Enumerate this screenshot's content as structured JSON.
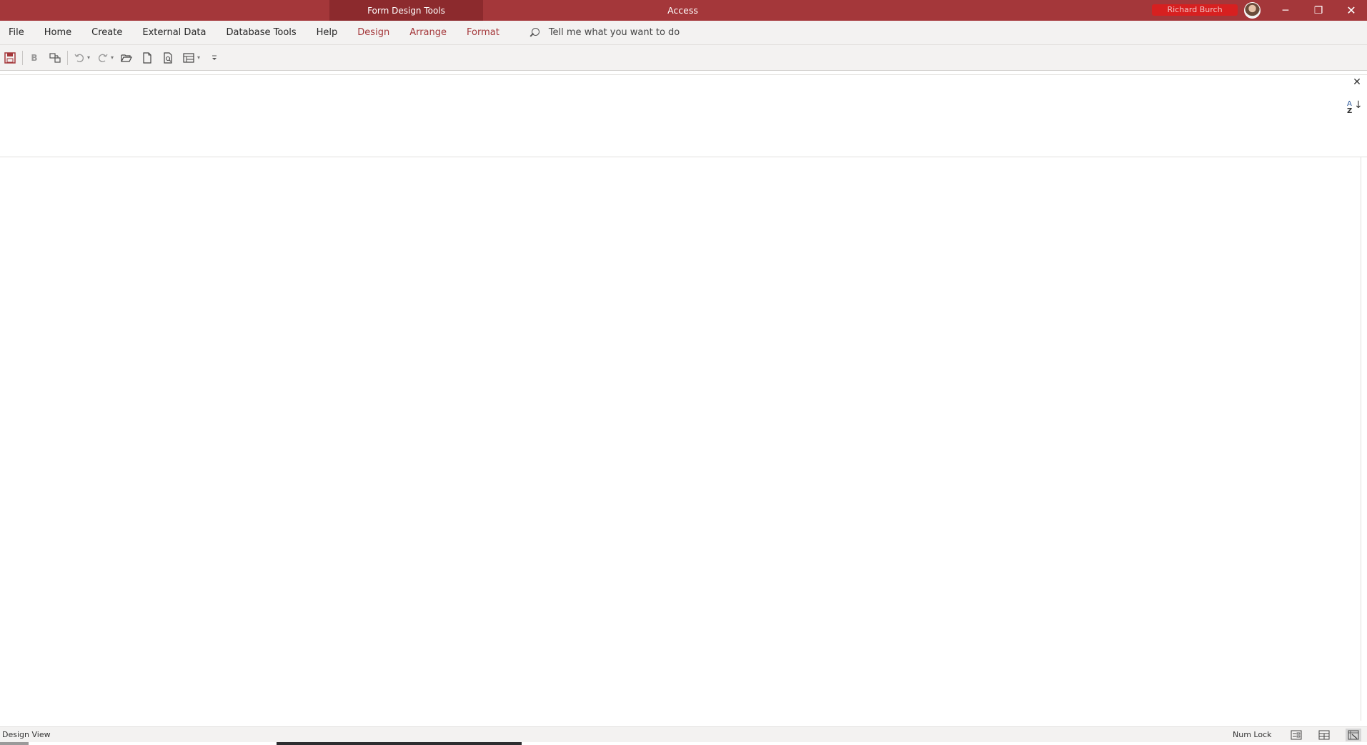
{
  "titlebar": {
    "context_label": "Form Design Tools",
    "app_name": "Access",
    "user_name": "Richard Burch",
    "minimize": "─",
    "restore": "❐",
    "close": "✕"
  },
  "ribbon": {
    "tabs": [
      {
        "label": "File"
      },
      {
        "label": "Home"
      },
      {
        "label": "Create"
      },
      {
        "label": "External Data"
      },
      {
        "label": "Database Tools"
      },
      {
        "label": "Help"
      },
      {
        "label": "Design"
      },
      {
        "label": "Arrange"
      },
      {
        "label": "Format"
      }
    ],
    "tell_me": "Tell me what you want to do"
  },
  "qat": {
    "bold": "B"
  },
  "pane": {
    "close": "✕",
    "sort_top": "A",
    "sort_bottom": "Z",
    "sort_arrow": "↓"
  },
  "status": {
    "mode": "Design View",
    "num_lock": "Num Lock"
  },
  "colors": {
    "brand": "#a4373a",
    "context_tab": "#8c2a2d"
  }
}
